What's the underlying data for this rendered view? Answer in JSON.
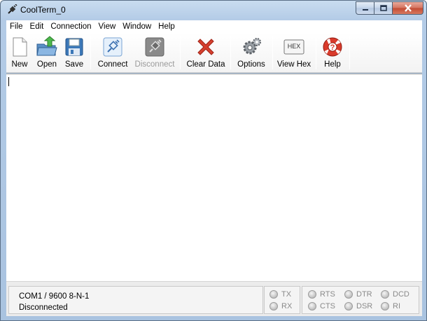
{
  "window": {
    "title": "CoolTerm_0"
  },
  "menu": [
    "File",
    "Edit",
    "Connection",
    "View",
    "Window",
    "Help"
  ],
  "toolbar": {
    "new": "New",
    "open": "Open",
    "save": "Save",
    "connect": "Connect",
    "disconnect": "Disconnect",
    "clear_data": "Clear Data",
    "options": "Options",
    "view_hex": "View Hex",
    "hex_badge": "HEX",
    "help": "Help"
  },
  "status": {
    "port_settings": "COM1 / 9600 8-N-1",
    "connection_state": "Disconnected"
  },
  "leds": {
    "tx": "TX",
    "rx": "RX",
    "rts": "RTS",
    "cts": "CTS",
    "dtr": "DTR",
    "dsr": "DSR",
    "dcd": "DCD",
    "ri": "RI"
  },
  "colors": {
    "title_bar": "#b3cbe6",
    "close_button": "#c24a33",
    "clear_icon": "#d6402f",
    "save_icon": "#3c78b8",
    "open_icon": "#3aa73a"
  }
}
